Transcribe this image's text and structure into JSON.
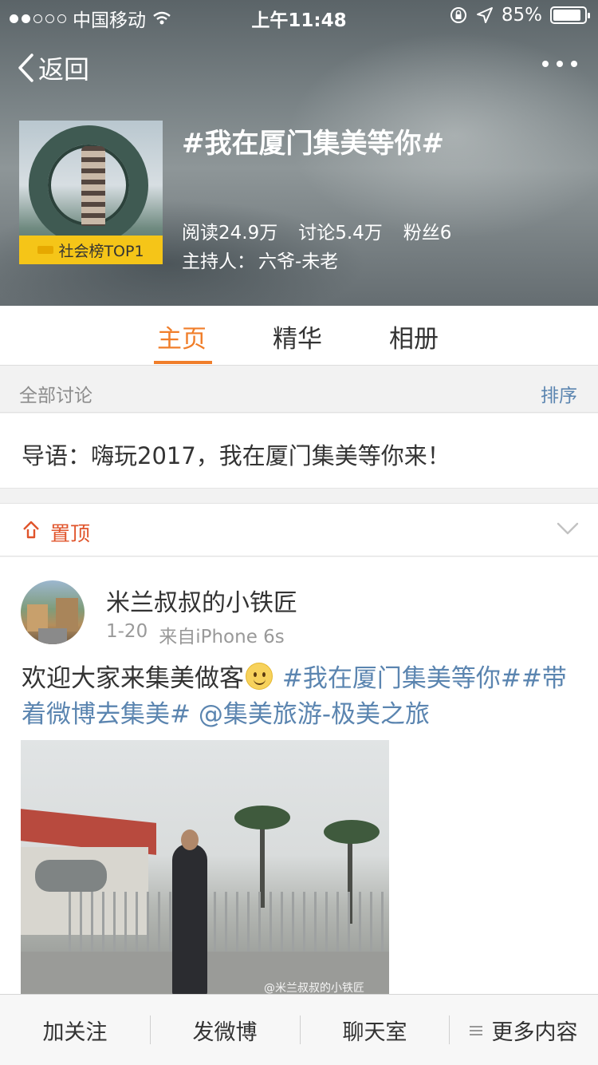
{
  "status_bar": {
    "carrier": "中国移动",
    "time": "上午11:48",
    "battery": "85%",
    "signal_dots_filled": 2,
    "signal_dots_total": 5
  },
  "nav": {
    "back_label": "返回"
  },
  "topic": {
    "title": "#我在厦门集美等你#",
    "badge": "社会榜TOP1",
    "reads": "阅读24.9万",
    "discussions": "讨论5.4万",
    "fans": "粉丝6",
    "host_label": "主持人：",
    "host_name": "六爷-未老"
  },
  "tabs": [
    {
      "label": "主页",
      "active": true
    },
    {
      "label": "精华",
      "active": false
    },
    {
      "label": "相册",
      "active": false
    }
  ],
  "section": {
    "label": "全部讨论",
    "sort_label": "排序"
  },
  "guide": {
    "text": "导语：嗨玩2017，我在厦门集美等你来！"
  },
  "pinned": {
    "label": "置顶"
  },
  "post": {
    "username": "米兰叔叔的小铁匠",
    "date": "1-20",
    "source": "来自iPhone 6s",
    "text_prefix": "欢迎大家来集美做客",
    "hashtag1": "#我在厦门集美等你#",
    "hashtag2": "#带着微博去集美#",
    "mention": "@集美旅游-极美之旅",
    "watermark": "@米兰叔叔的小铁匠"
  },
  "bottom_bar": {
    "follow": "加关注",
    "post": "发微博",
    "chat": "聊天室",
    "more": "更多内容"
  },
  "colors": {
    "accent": "#f07e2a",
    "link": "#5b85b0",
    "pinned": "#e0542b",
    "badge": "#f5c518"
  }
}
